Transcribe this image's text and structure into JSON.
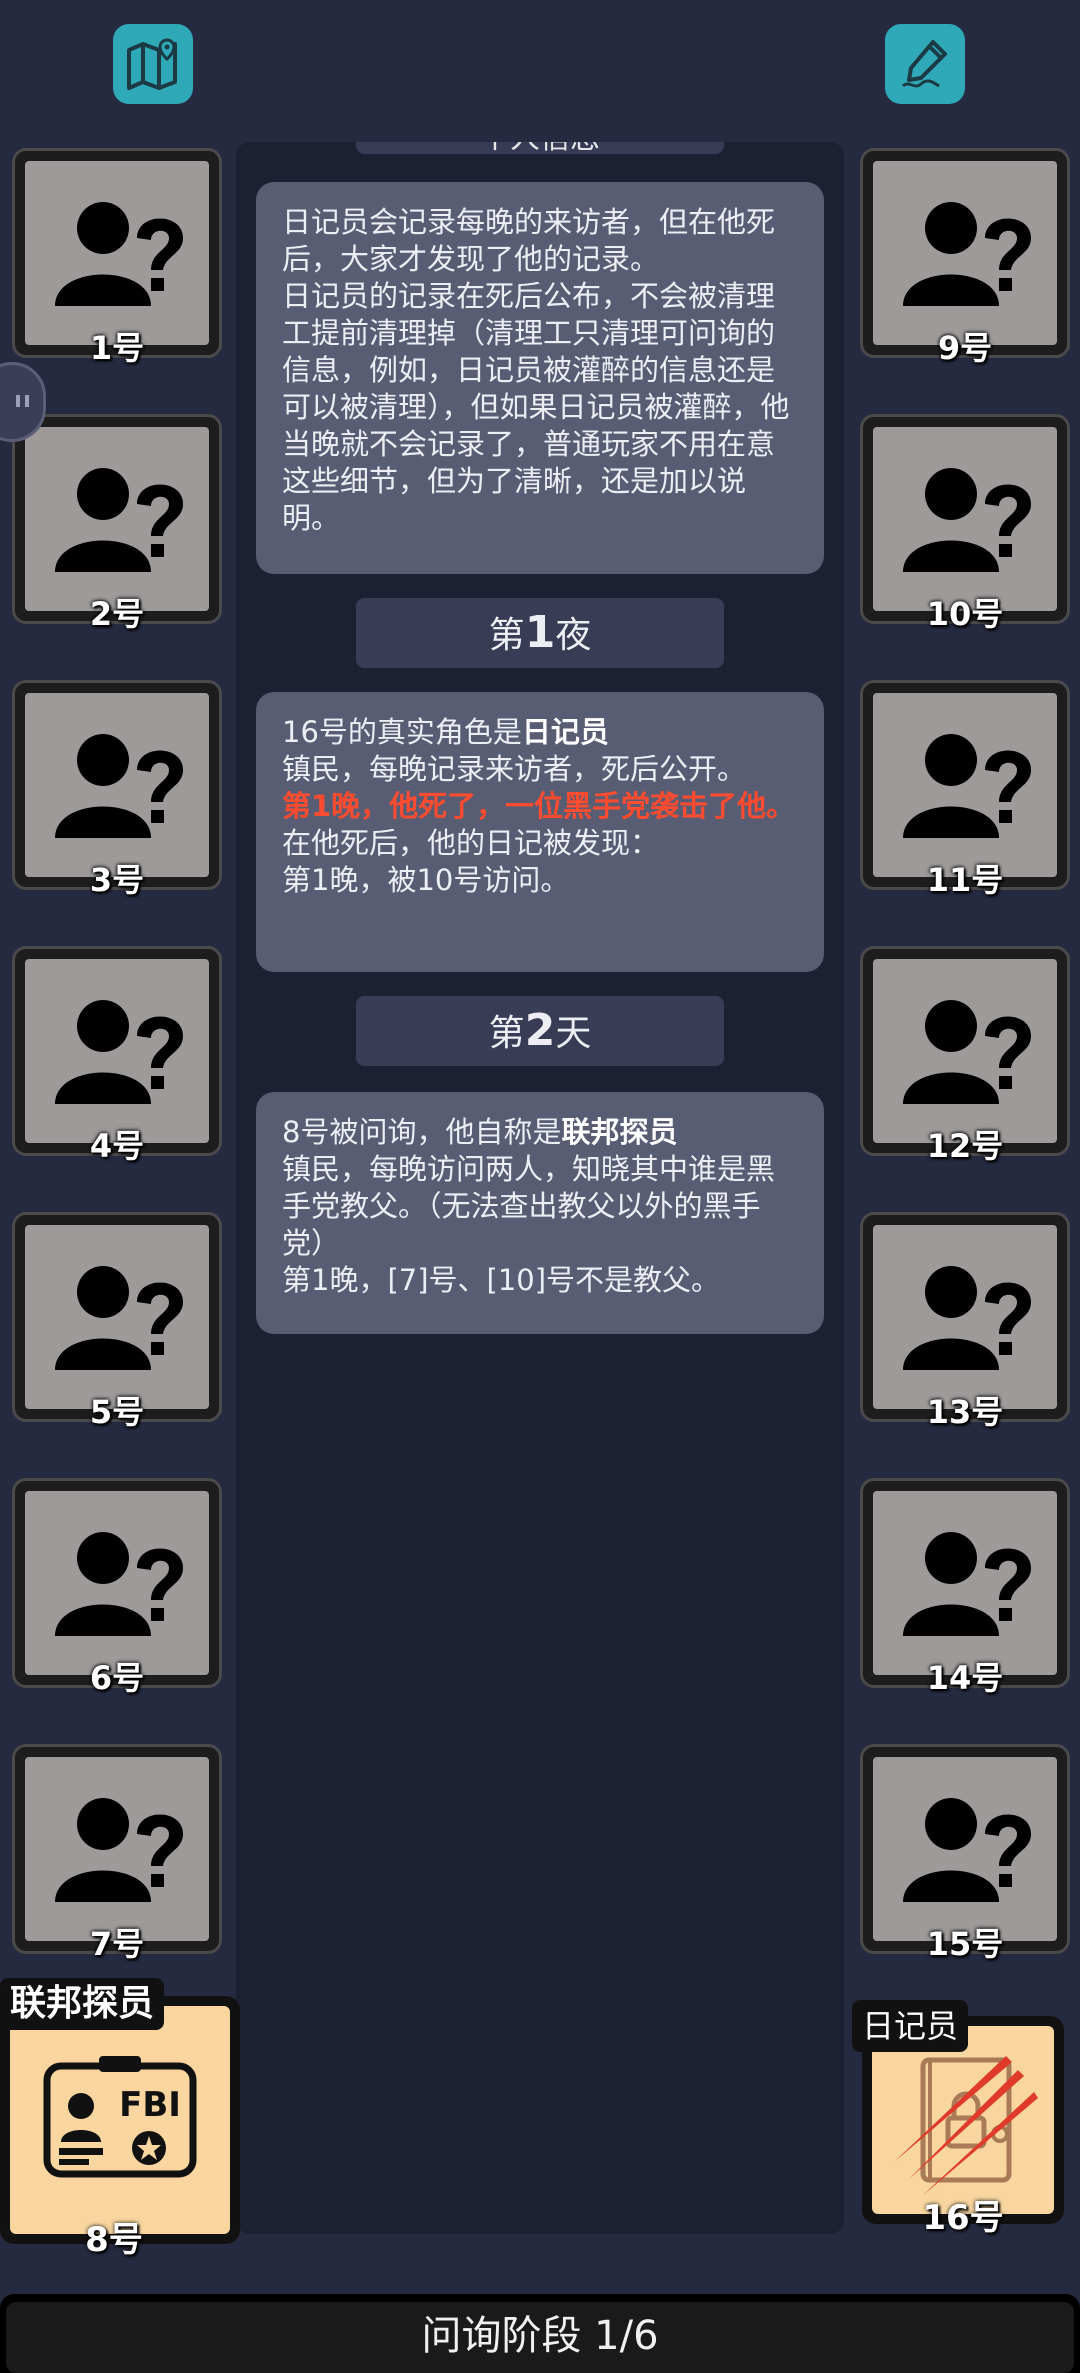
{
  "top_left_icon": "map-icon",
  "top_right_icon": "edit-note-icon",
  "log": {
    "partial_header": "个人信息",
    "msg1": "日记员会记录每晚的来访者，但在他死后，大家才发现了他的记录。\n日记员的记录在死后公布，不会被清理工提前清理掉（清理工只清理可问询的信息，例如，日记员被灌醉的信息还是可以被清理），但如果日记员被灌醉，他当晚就不会记录了，普通玩家不用在意这些细节，但为了清晰，还是加以说明。",
    "sep1_prefix": "第",
    "sep1_num": "1",
    "sep1_suffix": "夜",
    "msg2_line1_prefix": "16号的真实角色是",
    "msg2_line1_role": "日记员",
    "msg2_line2": "镇民，每晚记录来访者，死后公开。",
    "msg2_red": "第1晚，他死了，一位黑手党袭击了他。",
    "msg2_line4": "在他死后，他的日记被发现：",
    "msg2_line5": "第1晚，被10号访问。",
    "sep2_prefix": "第",
    "sep2_num": "2",
    "sep2_suffix": "天",
    "msg3_line1_prefix": "8号被问询，他自称是",
    "msg3_line1_role": "联邦探员",
    "msg3_line2": "镇民，每晚访问两人，知晓其中谁是黑手党教父。（无法查出教父以外的黑手党）",
    "msg3_line3": "第1晚，[7]号、[10]号不是教父。"
  },
  "players_left": [
    "1号",
    "2号",
    "3号",
    "4号",
    "5号",
    "6号",
    "7号"
  ],
  "players_right": [
    "9号",
    "10号",
    "11号",
    "12号",
    "13号",
    "14号",
    "15号"
  ],
  "role8": {
    "tag": "联邦探员",
    "label": "8号",
    "icon": "fbi-badge-icon",
    "badge_text": "FBI"
  },
  "role16": {
    "tag": "日记员",
    "label": "16号",
    "icon": "diary-slashed-icon"
  },
  "bottom": {
    "phase": "问询阶段 1/6"
  },
  "colors": {
    "background": "#252a40",
    "panel": "#1c2033",
    "message": "#585d74",
    "accent_teal": "#2fa9b8",
    "role_card": "#f9d6a0",
    "alert_red": "#ff4b2f"
  }
}
